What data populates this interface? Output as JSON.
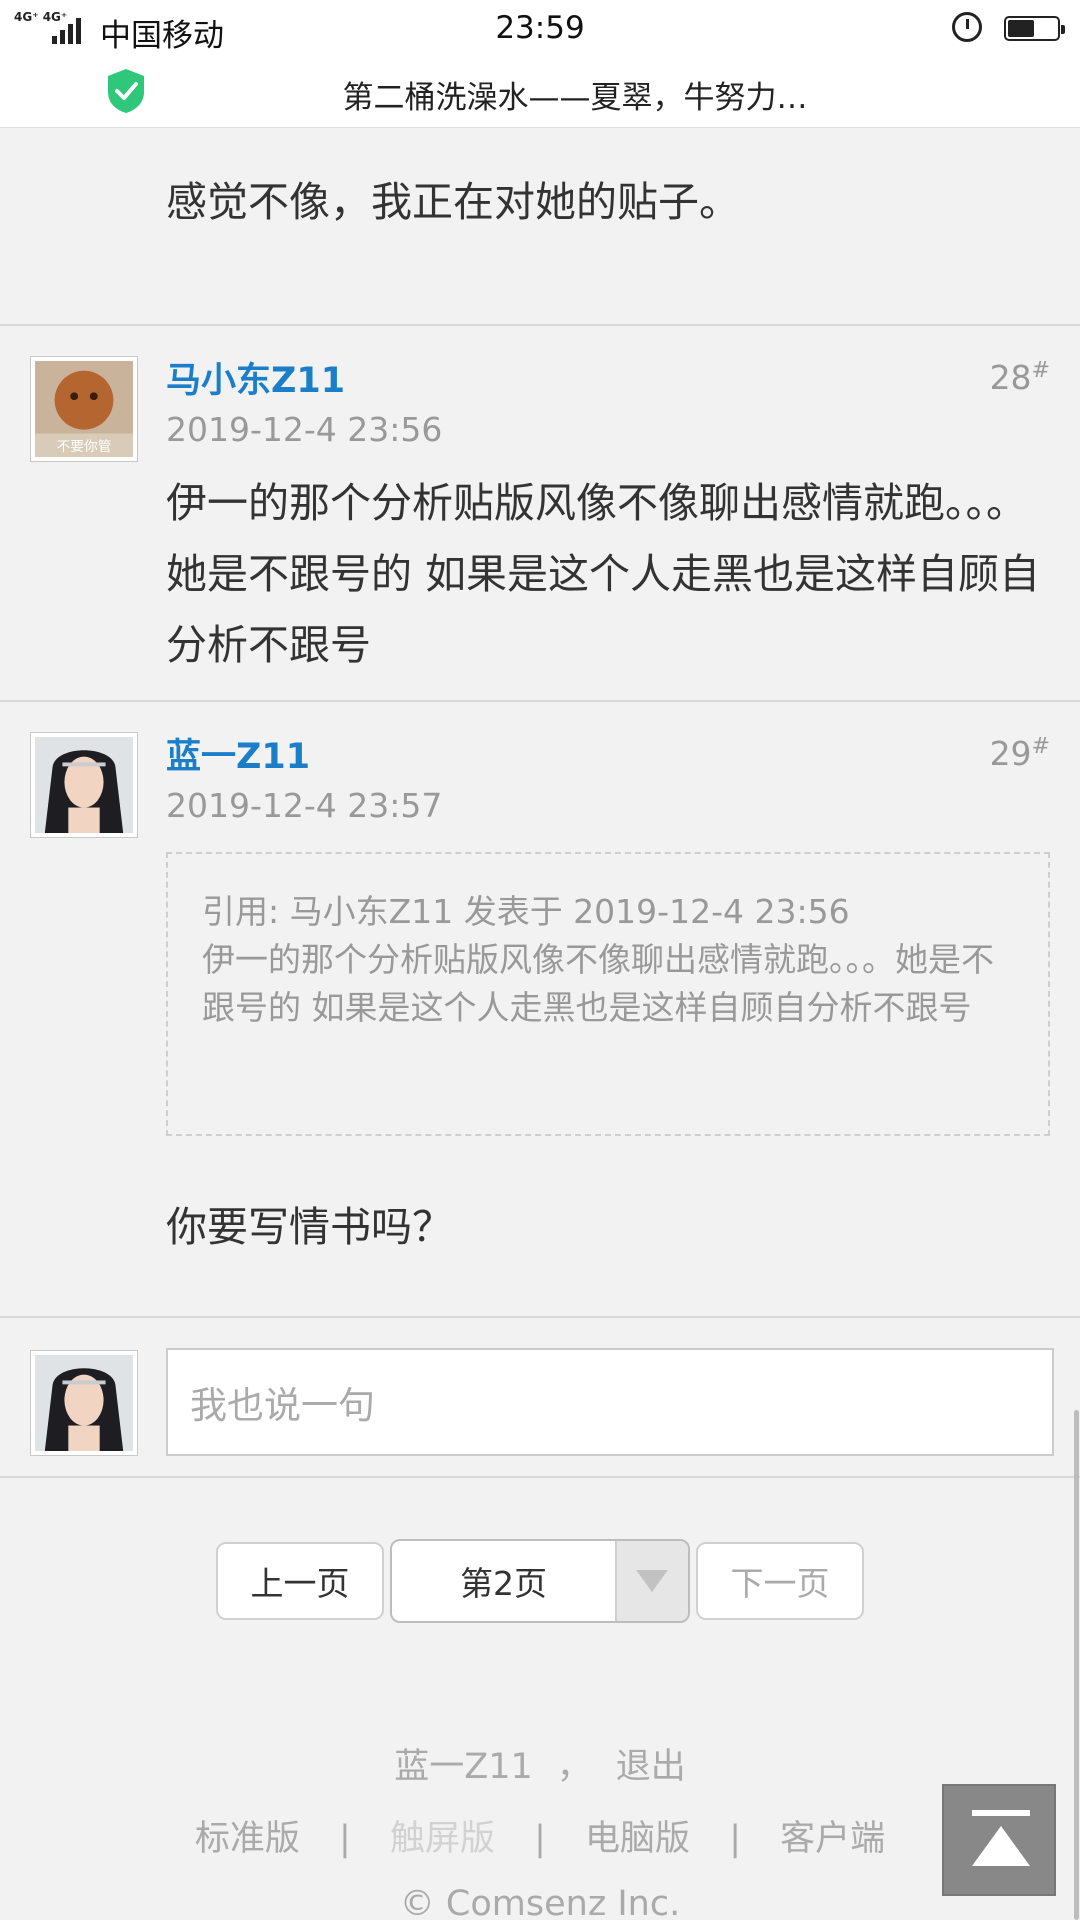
{
  "status_bar": {
    "network": "4G⁺ 4G⁺",
    "carrier": "中国移动",
    "time": "23:59",
    "alarm_icon": "alarm-icon",
    "battery_icon": "battery-icon",
    "battery_level": 0.5
  },
  "title_bar": {
    "title": "第二桶洗澡水——夏翠，牛努力…",
    "shield_icon": "shield-check-icon",
    "shield_color": "#2fc77a"
  },
  "posts": {
    "prev_tail": "感觉不像，我正在对她的贴子。",
    "p28": {
      "author": "马小东Z11",
      "floor": "28",
      "floor_mark": "#",
      "date": "2019-12-4 23:56",
      "content": "伊一的那个分析贴版风像不像聊出感情就跑。。。她是不跟号的 如果是这个人走黑也是这样自顾自分析不跟号"
    },
    "p29": {
      "author": "蓝一Z11",
      "floor": "29",
      "floor_mark": "#",
      "date": "2019-12-4 23:57",
      "quote_header": "引用: 马小东Z11 发表于 2019-12-4 23:56",
      "quote_body": "伊一的那个分析贴版风像不像聊出感情就跑。。。她是不跟号的 如果是这个人走黑也是这样自顾自分析不跟号",
      "content": "你要写情书吗？"
    }
  },
  "reply": {
    "placeholder": "我也说一句"
  },
  "pager": {
    "prev": "上一页",
    "current": "第2页",
    "next": "下一页"
  },
  "footer": {
    "username": "蓝一Z11",
    "separator": "，",
    "logout": "退出",
    "links": [
      "标准版",
      "触屏版",
      "电脑版",
      "客户端"
    ],
    "divider": "|",
    "copyright": "© Comsenz Inc."
  },
  "colors": {
    "author_link": "#1a7ec9",
    "muted": "#999999",
    "background": "#f2f2f2"
  }
}
